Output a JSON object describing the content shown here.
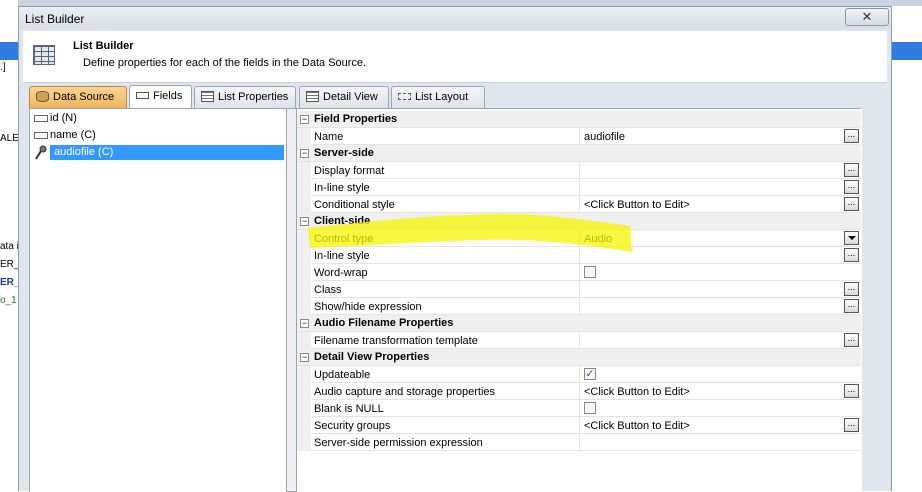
{
  "window": {
    "title": "List Builder",
    "close_glyph": "✕"
  },
  "header": {
    "title": "List Builder",
    "description": "Define properties for each of the fields in the Data Source."
  },
  "tabs": [
    {
      "label": "Data Source",
      "icon": "database-icon"
    },
    {
      "label": "Fields",
      "icon": "fields-icon"
    },
    {
      "label": "List Properties",
      "icon": "list-properties-icon"
    },
    {
      "label": "Detail View",
      "icon": "detail-view-icon"
    },
    {
      "label": "List Layout",
      "icon": "list-layout-icon"
    }
  ],
  "fields": [
    {
      "label": "id (N)",
      "icon": "field-icon"
    },
    {
      "label": "name (C)",
      "icon": "field-icon"
    },
    {
      "label": "audiofile (C)",
      "icon": "microphone-icon"
    }
  ],
  "background_fragments": [
    ".]",
    "ALE",
    "ata i",
    "ER_",
    "ER_",
    "o_1"
  ],
  "properties": {
    "ellipsis": "...",
    "check": "✓",
    "field_properties": {
      "title": "Field Properties",
      "name_label": "Name",
      "name_value": "audiofile"
    },
    "server_side": {
      "title": "Server-side",
      "display_format": "Display format",
      "inline_style": "In-line style",
      "conditional_style": "Conditional style",
      "conditional_style_value": "<Click Button to Edit>"
    },
    "client_side": {
      "title": "Client-side",
      "control_type": "Control type",
      "control_type_value": "Audio",
      "inline_style": "In-line style",
      "word_wrap": "Word-wrap",
      "class": "Class",
      "show_hide": "Show/hide expression"
    },
    "audio_filename": {
      "title": "Audio Filename Properties",
      "transformation": "Filename transformation template"
    },
    "detail_view": {
      "title": "Detail View Properties",
      "updateable": "Updateable",
      "updateable_checked": true,
      "audio_capture": "Audio capture and storage properties",
      "audio_capture_value": "<Click Button to Edit>",
      "blank_is_null": "Blank is NULL",
      "blank_is_null_checked": false,
      "security_groups": "Security groups",
      "security_groups_value": "<Click Button to Edit>",
      "server_permission": "Server-side permission expression"
    }
  }
}
